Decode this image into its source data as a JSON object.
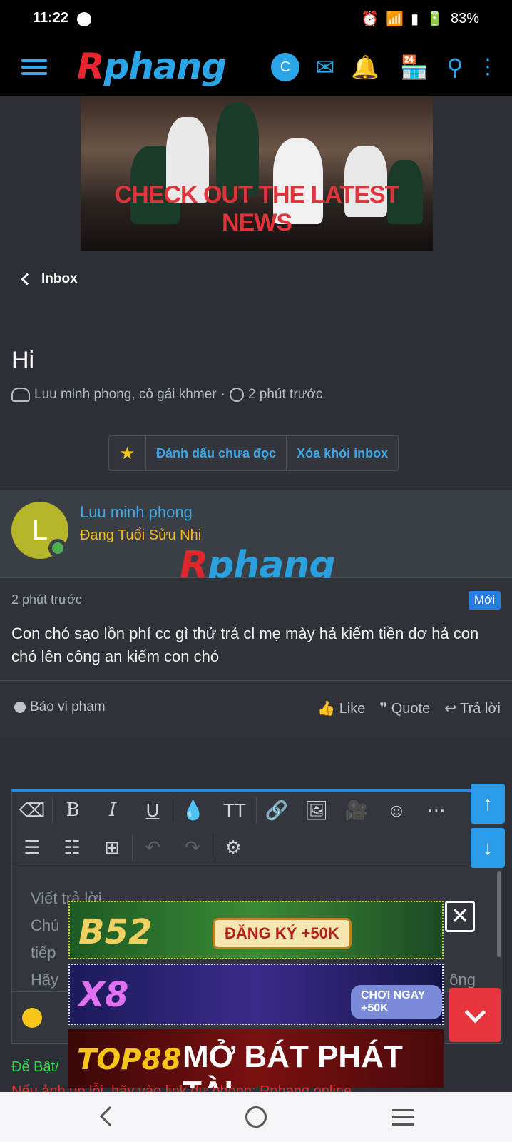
{
  "status": {
    "time": "11:22",
    "battery": "83%"
  },
  "appbar": {
    "logo_r": "R",
    "logo_rest": "phang",
    "user_initial": "C"
  },
  "banner": {
    "text": "CHECK OUT THE LATEST NEWS"
  },
  "nav": {
    "back_label": "Inbox"
  },
  "conversation": {
    "title": "Hi",
    "participants": "Luu minh phong, cô gái khmer",
    "separator": "·",
    "time": "2 phút trước",
    "mark_unread": "Đánh dấu chưa đọc",
    "remove_inbox": "Xóa khỏi inbox"
  },
  "message": {
    "author_initial": "L",
    "author": "Luu minh phong",
    "rank": "Đang Tuổi Sửu Nhi",
    "time": "2 phút trước",
    "badge": "Mới",
    "body": "Con chó sạo lồn phí cc gì thử trả cl mẹ mày hả kiếm tiền dơ hả con chó lên công an kiếm con chó",
    "report": "Báo vi phạm",
    "like": "Like",
    "quote": "Quote",
    "reply": "Trả lời"
  },
  "watermark": {
    "r": "R",
    "rest": "phang"
  },
  "editor": {
    "placeholder_lines": [
      "Viết trả lời...",
      "Chú",
      "tiếp",
      "Hãy"
    ],
    "placeholder_tail": "ông"
  },
  "ads": {
    "ad1_brand": "B52",
    "ad1_cta": "ĐĂNG KÝ +50K",
    "ad2_brand": "X8",
    "ad2_cta": "CHƠI NGAY +50K",
    "ad3_brand": "TOP88",
    "ad3_cta": "MỞ BÁT PHÁT TÀI"
  },
  "footer": {
    "line1": "Để Bật/",
    "line2": "Nếu ảnh up lỗi, hãy vào link dự phòng: Rphang.online"
  },
  "colors": {
    "accent": "#2aa6e8",
    "brand_red": "#e8242c",
    "badge": "#2a7be4",
    "rank": "#f5b820"
  }
}
